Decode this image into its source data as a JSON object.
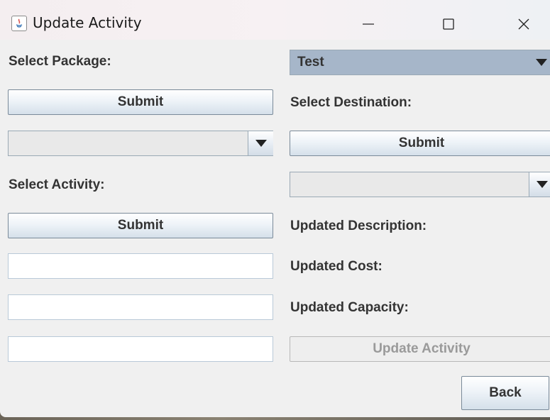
{
  "window": {
    "title": "Update Activity",
    "icon": "java-icon"
  },
  "controls": {
    "minimize": "minimize-icon",
    "maximize": "maximize-icon",
    "close": "close-icon"
  },
  "left": {
    "select_package_label": "Select Package:",
    "submit_package": "Submit",
    "destination_combo_value": "",
    "select_activity_label": "Select Activity:",
    "submit_activity": "Submit",
    "description_value": "",
    "cost_value": "",
    "capacity_value": ""
  },
  "right": {
    "package_combo_value": "Test",
    "select_destination_label": "Select Destination:",
    "submit_destination": "Submit",
    "activity_combo_value": "",
    "updated_description_label": "Updated Description:",
    "updated_cost_label": "Updated Cost:",
    "updated_capacity_label": "Updated Capacity:",
    "update_activity_button": "Update Activity",
    "back_button": "Back"
  },
  "colors": {
    "selected_combo": "#a6b6c9",
    "window_bg": "#f0f0f0"
  }
}
